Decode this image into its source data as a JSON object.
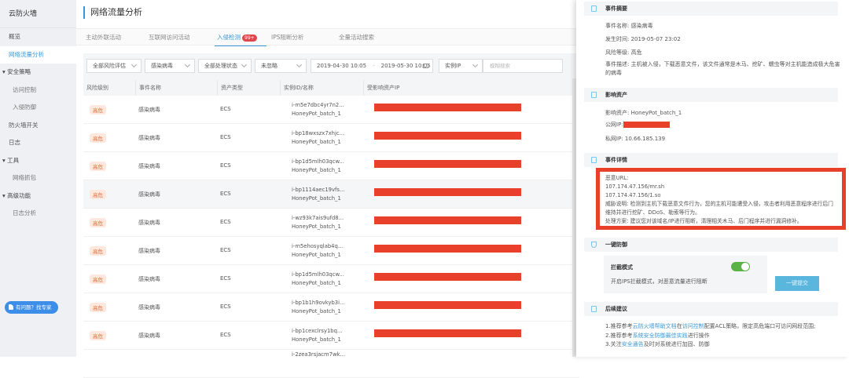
{
  "sidebar": {
    "title": "云防火墙",
    "items": [
      {
        "label": "概览",
        "type": "item"
      },
      {
        "label": "网络流量分析",
        "type": "active"
      },
      {
        "label": "▾ 安全策略",
        "type": "group"
      },
      {
        "label": "访问控制",
        "type": "sub"
      },
      {
        "label": "入侵防御",
        "type": "sub"
      },
      {
        "label": "防火墙开关",
        "type": "item"
      },
      {
        "label": "日志",
        "type": "item"
      },
      {
        "label": "▾ 工具",
        "type": "group"
      },
      {
        "label": "网络抓包",
        "type": "sub"
      },
      {
        "label": "▾ 高级功能",
        "type": "group"
      },
      {
        "label": "日志分析",
        "type": "sub"
      }
    ],
    "help": "有问题？找专家"
  },
  "header": {
    "title": "网络流量分析"
  },
  "tabs": [
    {
      "label": "主动外联活动"
    },
    {
      "label": "互联网访问活动"
    },
    {
      "label": "入侵检测",
      "badge": "99+"
    },
    {
      "label": "IPS阻断分析"
    },
    {
      "label": "全量活动搜索"
    }
  ],
  "filters": {
    "risk": "全部风险评估",
    "event": "感染病毒",
    "status": "全部处理状态",
    "ignore": "未忽略",
    "date_start": "2019-04-30 10:05",
    "date_sep": "-",
    "date_end": "2019-05-30 10:05",
    "search_type": "实例IP",
    "search_placeholder": "模糊搜索"
  },
  "table": {
    "headers": [
      "风险级别",
      "事件名称",
      "资产类型",
      "实例ID/名称",
      "受影响资产IP"
    ],
    "rows": [
      {
        "risk": "高危",
        "event": "感染病毒",
        "type": "ECS",
        "id": "i-m5e7dbc4yr7n2...",
        "name": "HoneyPot_batch_1"
      },
      {
        "risk": "高危",
        "event": "感染病毒",
        "type": "ECS",
        "id": "i-bp18wxszx7xhjc...",
        "name": "HoneyPot_batch_1"
      },
      {
        "risk": "高危",
        "event": "感染病毒",
        "type": "ECS",
        "id": "i-bp1d5mlh03qcw...",
        "name": "HoneyPot_batch_1"
      },
      {
        "risk": "高危",
        "event": "感染病毒",
        "type": "ECS",
        "id": "i-bp1114aec19vfs...",
        "name": "HoneyPot_batch_1"
      },
      {
        "risk": "高危",
        "event": "感染病毒",
        "type": "ECS",
        "id": "i-wz93k7ais9ufd8...",
        "name": "HoneyPot_batch_1"
      },
      {
        "risk": "高危",
        "event": "感染病毒",
        "type": "ECS",
        "id": "i-m5ehosyqlab4q...",
        "name": "HoneyPot_batch_1"
      },
      {
        "risk": "高危",
        "event": "感染病毒",
        "type": "ECS",
        "id": "i-bp1d5mlh03qcw...",
        "name": "HoneyPot_batch_1"
      },
      {
        "risk": "高危",
        "event": "感染病毒",
        "type": "ECS",
        "id": "i-bp1b1h9ovkyb3i...",
        "name": "HoneyPot_batch_1"
      },
      {
        "risk": "高危",
        "event": "感染病毒",
        "type": "ECS",
        "id": "i-bp1cexclrsy1bq...",
        "name": "HoneyPot_batch_1"
      },
      {
        "risk": "",
        "event": "",
        "type": "",
        "id": "i-2zea3rsjacm7wk...",
        "name": ""
      }
    ]
  },
  "drawer": {
    "summary": {
      "title": "事件摘要",
      "name": "事件名称: 感染病毒",
      "time": "发生时间: 2019-05-07 23:02",
      "level": "风险等级: 高危",
      "desc": "事件描述: 主机被入侵，下载恶意文件，该文件通常是木马、挖矿、蠕虫等对主机能造成极大危害的病毒"
    },
    "asset": {
      "title": "影响资产",
      "asset": "影响资产: HoneyPot_batch_1",
      "public_ip": "公网IP:",
      "private_ip": "私网IP: 10.66.185.139"
    },
    "detail": {
      "title": "事件详情",
      "lines": [
        "恶意URL:",
        "107.174.47.156/mr.sh",
        "107.174.47.156/1.so",
        "威胁说明: 检测到主机下载恶意文件行为，您的主机可能遭受入侵，攻击者利用恶意程序进行后门维持并进行挖矿、DDoS、勒索等行为。",
        "处理方案: 建议您对该域名/IP进行阻断，清理相关木马、后门程序并进行漏洞修补。"
      ]
    },
    "defense": {
      "title": "一键防御",
      "mode": "拦截模式",
      "mode_desc": "开启IPS拦截模式，对恶意流量进行阻断",
      "toggle_on": true,
      "button": "一键提交"
    },
    "suggest": {
      "title": "后续建议",
      "l1": [
        "1.推荐参考",
        "云防火墙帮助文档",
        "在",
        "访问控制",
        "配置ACL策略，限定高危端口可访问网段范围;"
      ],
      "l2": [
        "2.推荐参考",
        "系统安全防御最佳实践",
        "进行操作"
      ],
      "l3": [
        "3.关注",
        "安全通告",
        "及时对系统进行加固、防御"
      ]
    }
  },
  "colors": {
    "accent": "#3a9ad9",
    "redact": "#e8402a",
    "toggle": "#5bb347"
  }
}
